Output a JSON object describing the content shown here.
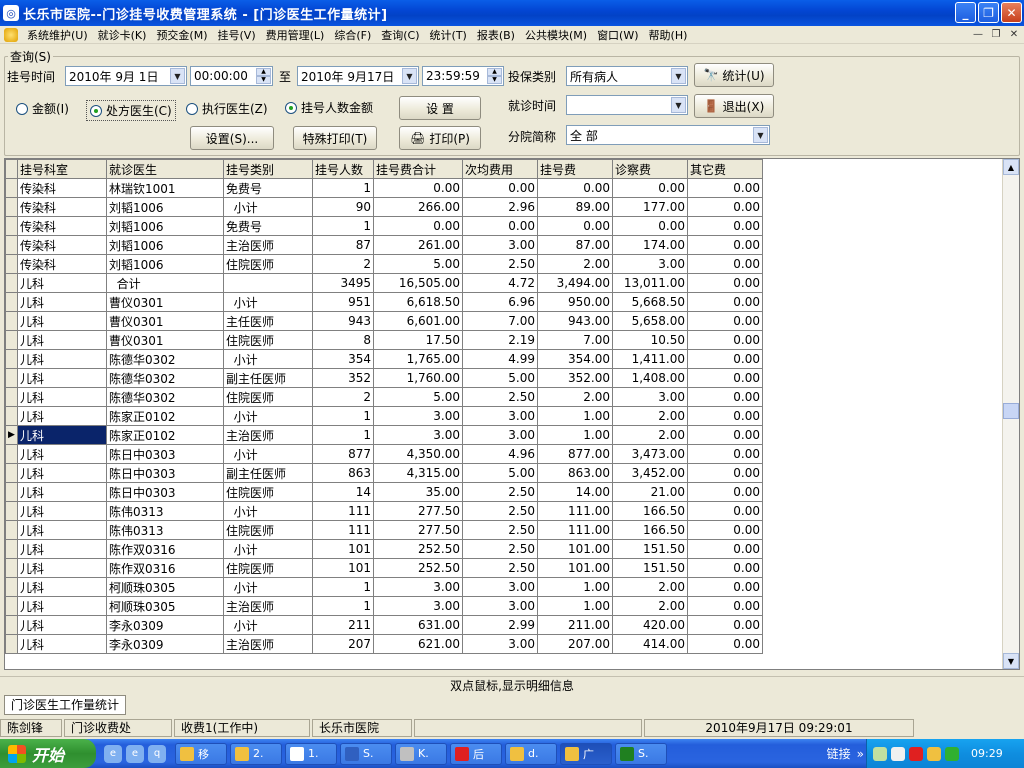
{
  "window": {
    "title": "长乐市医院--门诊挂号收费管理系统 - [门诊医生工作量统计]",
    "minimize": "_",
    "restore": "❐",
    "close": "✕"
  },
  "menu": [
    "系统维护(U)",
    "就诊卡(K)",
    "预交金(M)",
    "挂号(V)",
    "费用管理(L)",
    "综合(F)",
    "查询(C)",
    "统计(T)",
    "报表(B)",
    "公共模块(M)",
    "窗口(W)",
    "帮助(H)"
  ],
  "query": {
    "group_label": "查询(S)",
    "reg_time_label": "挂号时间",
    "date_from": "2010年 9月 1日",
    "time_from": "00:00:00",
    "to_label": "至",
    "date_to": "2010年 9月17日",
    "time_to": "23:59:59",
    "insurance_label": "投保类别",
    "insurance_value": "所有病人",
    "stat_button": "统计(U)",
    "exit_button": "退出(X)",
    "radio_amount": "金额(I)",
    "radio_prescribing": "处方医生(C)",
    "radio_executing": "执行医生(Z)",
    "radio_count_amount": "挂号人数金额",
    "setup_button": "设  置",
    "visit_time_label": "就诊时间",
    "visit_time_value": "",
    "settings_button": "设置(S)...",
    "special_print_button": "特殊打印(T)",
    "print_button": "打印(P)",
    "branch_label": "分院简称",
    "branch_value": "全 部"
  },
  "grid": {
    "columns": [
      "挂号科室",
      "就诊医生",
      "挂号类别",
      "挂号人数",
      "挂号费合计",
      "次均费用",
      "挂号费",
      "诊察费",
      "其它费"
    ],
    "rows": [
      [
        "传染科",
        "林瑞钦1001",
        "免费号",
        "1",
        "0.00",
        "0.00",
        "0.00",
        "0.00",
        "0.00"
      ],
      [
        "传染科",
        "刘韬1006",
        "  小计",
        "90",
        "266.00",
        "2.96",
        "89.00",
        "177.00",
        "0.00"
      ],
      [
        "传染科",
        "刘韬1006",
        "免费号",
        "1",
        "0.00",
        "0.00",
        "0.00",
        "0.00",
        "0.00"
      ],
      [
        "传染科",
        "刘韬1006",
        "主治医师",
        "87",
        "261.00",
        "3.00",
        "87.00",
        "174.00",
        "0.00"
      ],
      [
        "传染科",
        "刘韬1006",
        "住院医师",
        "2",
        "5.00",
        "2.50",
        "2.00",
        "3.00",
        "0.00"
      ],
      [
        "儿科",
        "  合计",
        "",
        "3495",
        "16,505.00",
        "4.72",
        "3,494.00",
        "13,011.00",
        "0.00"
      ],
      [
        "儿科",
        "曹仪0301",
        "  小计",
        "951",
        "6,618.50",
        "6.96",
        "950.00",
        "5,668.50",
        "0.00"
      ],
      [
        "儿科",
        "曹仪0301",
        "主任医师",
        "943",
        "6,601.00",
        "7.00",
        "943.00",
        "5,658.00",
        "0.00"
      ],
      [
        "儿科",
        "曹仪0301",
        "住院医师",
        "8",
        "17.50",
        "2.19",
        "7.00",
        "10.50",
        "0.00"
      ],
      [
        "儿科",
        "陈德华0302",
        "  小计",
        "354",
        "1,765.00",
        "4.99",
        "354.00",
        "1,411.00",
        "0.00"
      ],
      [
        "儿科",
        "陈德华0302",
        "副主任医师",
        "352",
        "1,760.00",
        "5.00",
        "352.00",
        "1,408.00",
        "0.00"
      ],
      [
        "儿科",
        "陈德华0302",
        "住院医师",
        "2",
        "5.00",
        "2.50",
        "2.00",
        "3.00",
        "0.00"
      ],
      [
        "儿科",
        "陈家正0102",
        "  小计",
        "1",
        "3.00",
        "3.00",
        "1.00",
        "2.00",
        "0.00"
      ],
      [
        "儿科",
        "陈家正0102",
        "主治医师",
        "1",
        "3.00",
        "3.00",
        "1.00",
        "2.00",
        "0.00"
      ],
      [
        "儿科",
        "陈日中0303",
        "  小计",
        "877",
        "4,350.00",
        "4.96",
        "877.00",
        "3,473.00",
        "0.00"
      ],
      [
        "儿科",
        "陈日中0303",
        "副主任医师",
        "863",
        "4,315.00",
        "5.00",
        "863.00",
        "3,452.00",
        "0.00"
      ],
      [
        "儿科",
        "陈日中0303",
        "住院医师",
        "14",
        "35.00",
        "2.50",
        "14.00",
        "21.00",
        "0.00"
      ],
      [
        "儿科",
        "陈伟0313",
        "  小计",
        "111",
        "277.50",
        "2.50",
        "111.00",
        "166.50",
        "0.00"
      ],
      [
        "儿科",
        "陈伟0313",
        "住院医师",
        "111",
        "277.50",
        "2.50",
        "111.00",
        "166.50",
        "0.00"
      ],
      [
        "儿科",
        "陈作双0316",
        "  小计",
        "101",
        "252.50",
        "2.50",
        "101.00",
        "151.50",
        "0.00"
      ],
      [
        "儿科",
        "陈作双0316",
        "住院医师",
        "101",
        "252.50",
        "2.50",
        "101.00",
        "151.50",
        "0.00"
      ],
      [
        "儿科",
        "柯顺珠0305",
        "  小计",
        "1",
        "3.00",
        "3.00",
        "1.00",
        "2.00",
        "0.00"
      ],
      [
        "儿科",
        "柯顺珠0305",
        "主治医师",
        "1",
        "3.00",
        "3.00",
        "1.00",
        "2.00",
        "0.00"
      ],
      [
        "儿科",
        "李永0309",
        "  小计",
        "211",
        "631.00",
        "2.99",
        "211.00",
        "420.00",
        "0.00"
      ],
      [
        "儿科",
        "李永0309",
        "主治医师",
        "207",
        "621.00",
        "3.00",
        "207.00",
        "414.00",
        "0.00"
      ]
    ],
    "selected_row": 13
  },
  "hint": "双点鼠标,显示明细信息",
  "mdi_tab": "门诊医生工作量统计",
  "statusbar": [
    "陈剑锋",
    "门诊收费处",
    "收费1(工作中)",
    "长乐市医院",
    "",
    "2010年9月17日  09:29:01"
  ],
  "taskbar": {
    "start": "开始",
    "quick_launch": [
      "e",
      "e",
      "q"
    ],
    "buttons": [
      {
        "label": "移",
        "color": "#f0c040"
      },
      {
        "label": "2.",
        "color": "#f0c040"
      },
      {
        "label": "1.",
        "color": "#ffffff"
      },
      {
        "label": "S.",
        "color": "#3060c0"
      },
      {
        "label": "K.",
        "color": "#c0c0c0"
      },
      {
        "label": "后",
        "color": "#e02020"
      },
      {
        "label": "d.",
        "color": "#f0c040"
      },
      {
        "label": "广",
        "color": "#f0c040",
        "active": true
      },
      {
        "label": "S.",
        "color": "#208020"
      }
    ],
    "links_label": "链接",
    "clock": "09:29"
  }
}
